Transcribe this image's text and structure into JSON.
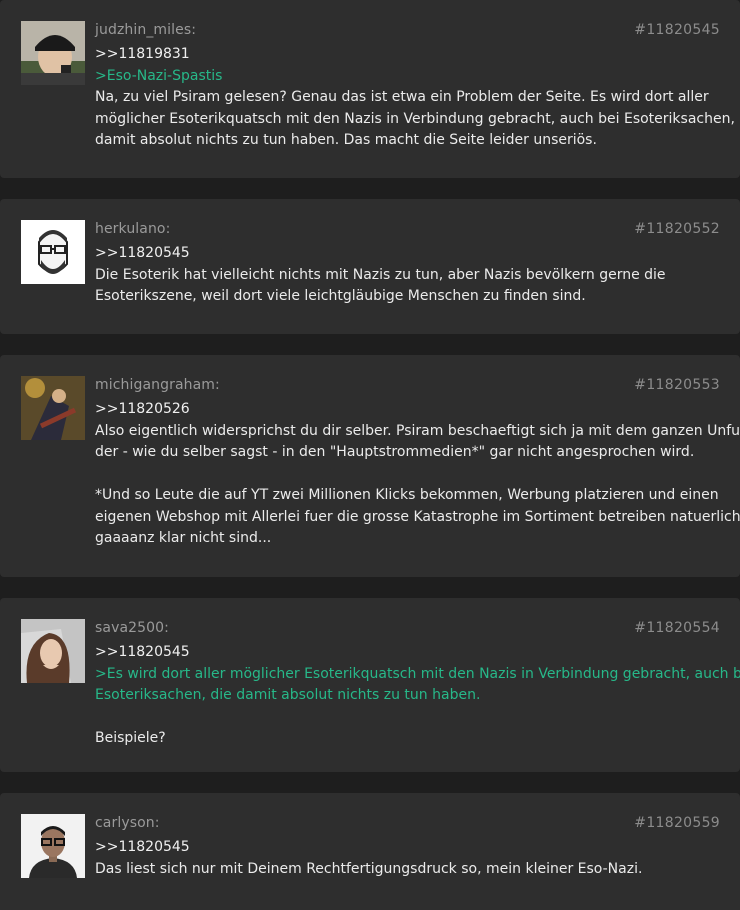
{
  "posts": [
    {
      "username": "judzhin_miles:",
      "number": "#11820545",
      "reply": ">>11819831",
      "lines": [
        {
          "type": "quote",
          "text": ">Eso-Nazi-Spastis"
        },
        {
          "type": "text",
          "text": "Na, zu viel Psiram gelesen? Genau das ist etwa ein Problem der Seite. Es wird dort aller"
        },
        {
          "type": "text",
          "text": "möglicher Esoterikquatsch mit den Nazis in Verbindung gebracht, auch bei Esoteriksachen, die"
        },
        {
          "type": "text",
          "text": "damit absolut nichts zu tun haben. Das macht die Seite leider unseriös."
        }
      ]
    },
    {
      "username": "herkulano:",
      "number": "#11820552",
      "reply": ">>11820545",
      "lines": [
        {
          "type": "text",
          "text": "Die Esoterik hat vielleicht nichts mit Nazis zu tun, aber Nazis bevölkern gerne die"
        },
        {
          "type": "text",
          "text": "Esoterikszene, weil dort viele leichtgläubige Menschen zu finden sind."
        }
      ]
    },
    {
      "username": "michigangraham:",
      "number": "#11820553",
      "reply": ">>11820526",
      "lines": [
        {
          "type": "text",
          "text": "Also eigentlich widersprichst du dir selber. Psiram beschaeftigt sich ja mit dem ganzen Unfug"
        },
        {
          "type": "text",
          "text": "der - wie du selber sagst - in den \"Hauptstrommedien*\" gar nicht angesprochen wird."
        },
        {
          "type": "gap",
          "text": ""
        },
        {
          "type": "text",
          "text": "*Und so Leute die auf YT zwei Millionen Klicks bekommen, Werbung platzieren und einen"
        },
        {
          "type": "text",
          "text": "eigenen Webshop mit Allerlei fuer die grosse Katastrophe im Sortiment betreiben natuerlich"
        },
        {
          "type": "text",
          "text": "gaaaanz klar nicht sind..."
        }
      ]
    },
    {
      "username": "sava2500:",
      "number": "#11820554",
      "reply": ">>11820545",
      "lines": [
        {
          "type": "quote",
          "text": ">Es wird dort aller möglicher Esoterikquatsch mit den Nazis in Verbindung gebracht, auch bei"
        },
        {
          "type": "quote",
          "text": "Esoteriksachen, die damit absolut nichts zu tun haben."
        },
        {
          "type": "gap",
          "text": ""
        },
        {
          "type": "text",
          "text": "Beispiele?"
        }
      ]
    },
    {
      "username": "carlyson:",
      "number": "#11820559",
      "reply": ">>11820545",
      "lines": [
        {
          "type": "text",
          "text": "Das liest sich nur mit Deinem Rechtfertigungsdruck so, mein kleiner Eso-Nazi."
        }
      ]
    }
  ]
}
